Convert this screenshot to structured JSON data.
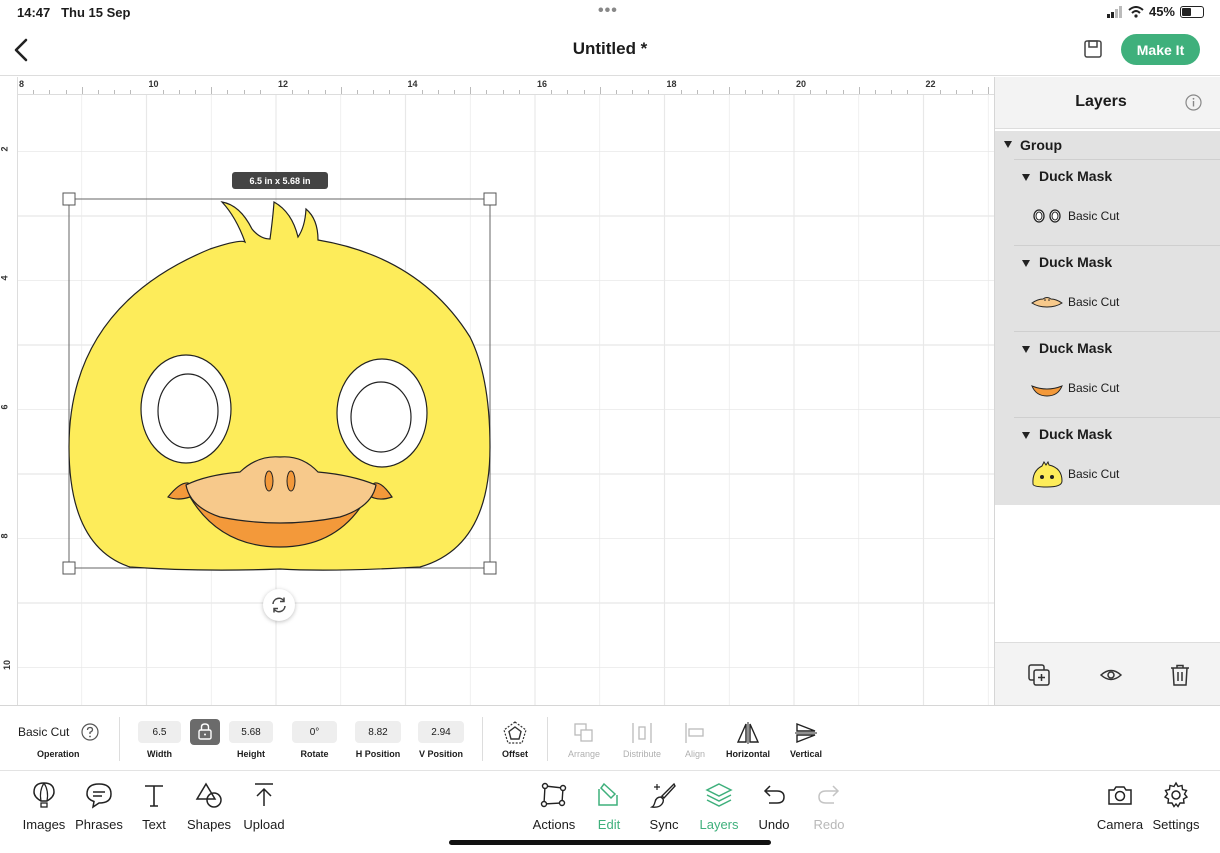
{
  "status_bar": {
    "time": "14:47",
    "date": "Thu 15 Sep",
    "battery": "45%",
    "battery_level": 0.45
  },
  "header": {
    "title": "Untitled *",
    "make_it_label": "Make It"
  },
  "canvas": {
    "ruler_top_labels": [
      "8",
      "10",
      "12",
      "14",
      "16",
      "18",
      "20",
      "22"
    ],
    "ruler_left_labels": [
      "2",
      "4",
      "6",
      "8",
      "10"
    ],
    "size_tooltip": "6.5 in x 5.68 in",
    "colors": {
      "face": "#fdec5a",
      "beak_top": "#f7c98b",
      "beak_bottom": "#f3993a",
      "grid": "#e8e8e8"
    }
  },
  "layers": {
    "title": "Layers",
    "group_label": "Group",
    "items": [
      {
        "name": "Duck Mask",
        "operation": "Basic Cut",
        "thumb": "eyes-thumbnail"
      },
      {
        "name": "Duck Mask",
        "operation": "Basic Cut",
        "thumb": "beak-top-thumbnail"
      },
      {
        "name": "Duck Mask",
        "operation": "Basic Cut",
        "thumb": "beak-bottom-thumbnail"
      },
      {
        "name": "Duck Mask",
        "operation": "Basic Cut",
        "thumb": "duck-face-thumbnail"
      }
    ]
  },
  "props": {
    "operation_value": "Basic Cut",
    "operation_label": "Operation",
    "width_value": "6.5",
    "width_label": "Width",
    "height_value": "5.68",
    "height_label": "Height",
    "rotate_value": "0°",
    "rotate_label": "Rotate",
    "hpos_value": "8.82",
    "hpos_label": "H Position",
    "vpos_value": "2.94",
    "vpos_label": "V Position",
    "offset_label": "Offset",
    "arrange_label": "Arrange",
    "distribute_label": "Distribute",
    "align_label": "Align",
    "horizontal_label": "Horizontal",
    "vertical_label": "Vertical"
  },
  "bottom_nav": {
    "images": "Images",
    "phrases": "Phrases",
    "text": "Text",
    "shapes": "Shapes",
    "upload": "Upload",
    "actions": "Actions",
    "edit": "Edit",
    "sync": "Sync",
    "layers": "Layers",
    "undo": "Undo",
    "redo": "Redo",
    "camera": "Camera",
    "settings": "Settings"
  }
}
